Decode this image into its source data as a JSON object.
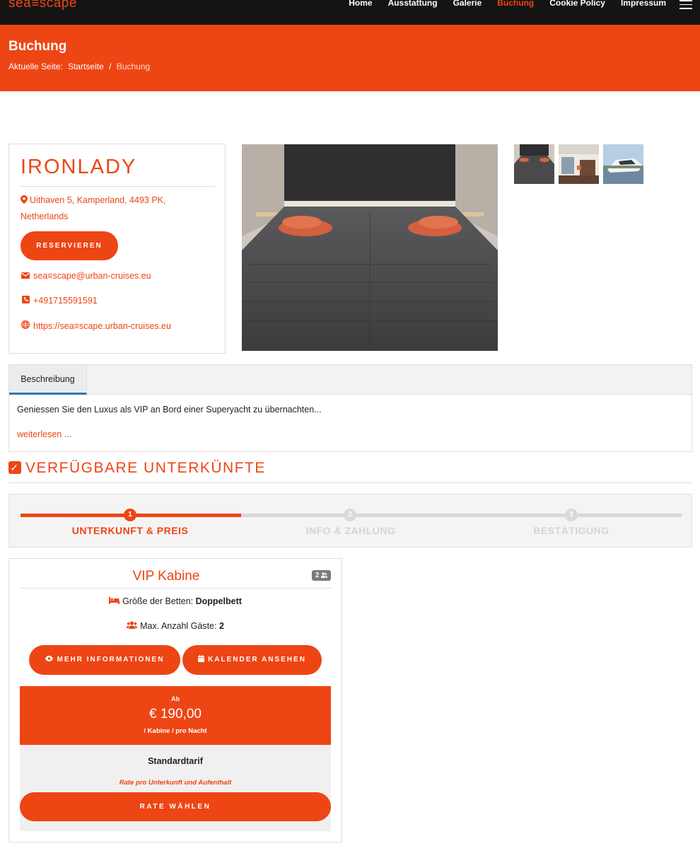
{
  "site": {
    "logo_text": "sea≡scape",
    "nav": [
      {
        "label": "Home",
        "active": false
      },
      {
        "label": "Ausstattung",
        "active": false
      },
      {
        "label": "Galerie",
        "active": false
      },
      {
        "label": "Buchung",
        "active": true
      },
      {
        "label": "Cookie Policy",
        "active": false
      },
      {
        "label": "Impressum",
        "active": false
      }
    ]
  },
  "page_header": {
    "title": "Buchung",
    "breadcrumb_prefix": "Aktuelle Seite:",
    "breadcrumb_home": "Startseite",
    "breadcrumb_sep": "/",
    "breadcrumb_current": "Buchung"
  },
  "property": {
    "name": "IRONLADY",
    "address": "Uithaven 5, Kamperland, 4493 PK, Netherlands",
    "reserve_label": "RESERVIEREN",
    "email": "sea≡scape@urban-cruises.eu",
    "phone": "+491715591591",
    "website": "https://sea≡scape.urban-cruises.eu"
  },
  "tabs": {
    "active_tab": "Beschreibung",
    "description": "Geniessen Sie den Luxus als VIP an Bord einer Superyacht zu übernachten...",
    "read_more": "weiterlesen ..."
  },
  "section": {
    "title": "VERFÜGBARE UNTERKÜNFTE"
  },
  "steps": [
    {
      "num": "1",
      "label": "UNTERKUNFT & PREIS",
      "active": true
    },
    {
      "num": "2",
      "label": "INFO & ZAHLUNG",
      "active": false
    },
    {
      "num": "3",
      "label": "BESTÄTIGUNG",
      "active": false
    }
  ],
  "room": {
    "name": "VIP Kabine",
    "capacity_badge": "2",
    "bed_label": "Größe der Betten:",
    "bed_value": "Doppelbett",
    "guests_label": "Max. Anzahl Gäste:",
    "guests_value": "2",
    "more_info_label": "MEHR INFORMATIONEN",
    "calendar_label": "KALENDER ANSEHEN",
    "price_from": "Ab",
    "price": "€ 190,00",
    "price_unit": "/ Kabine / pro Nacht",
    "rate_name": "Standardtarif",
    "rate_desc": "Rate pro Unterkunft und Aufenthalt",
    "rate_button": "RATE WÄHLEN"
  },
  "colors": {
    "accent": "#ee4514",
    "nav_bg": "#141414",
    "tab_underline": "#2e79b2"
  }
}
